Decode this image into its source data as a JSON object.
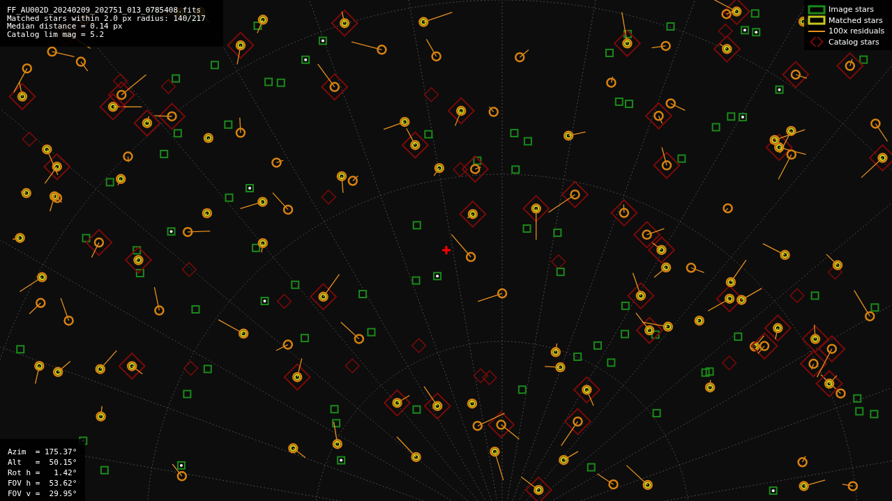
{
  "info_lines": [
    "FF_AU002D_20240209_202751_013_0785408.fits",
    "Matched stars within 2.0 px radius: 140/217",
    "Median distance = 0.14 px",
    "Catalog lim mag = 5.2"
  ],
  "legend": [
    {
      "kind": "box",
      "label": "Image stars",
      "color": "#1a8a1a"
    },
    {
      "kind": "box",
      "label": "Matched stars",
      "color": "#c8c81e"
    },
    {
      "kind": "line",
      "label": "100x residuals",
      "color": "#e8921e"
    },
    {
      "kind": "diamond",
      "label": "Catalog stars",
      "color": "#7a0a0a"
    }
  ],
  "pointing": [
    "Azim  = 175.37°",
    "Alt   =  50.15°",
    "Rot h =   1.42°",
    "FOV h =  53.62°",
    "FOV v =  29.95°"
  ]
}
